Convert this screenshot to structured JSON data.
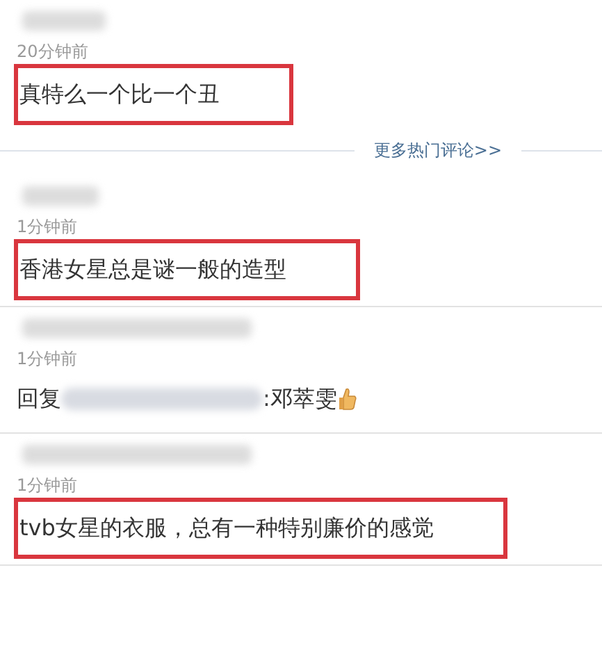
{
  "comments": [
    {
      "kind": "text",
      "time": "20分钟前",
      "text": "真特么一个比一个丑",
      "highlighted": true
    },
    {
      "kind": "more",
      "label": "更多热门评论>>"
    },
    {
      "kind": "text",
      "time": "1分钟前",
      "text": "香港女星总是谜一般的造型",
      "highlighted": true
    },
    {
      "kind": "reply",
      "time": "1分钟前",
      "prefix": "回复",
      "text": ":邓萃雯"
    },
    {
      "kind": "text",
      "time": "1分钟前",
      "text": "tvb女星的衣服，总有一种特别廉价的感觉",
      "highlighted": true
    }
  ]
}
